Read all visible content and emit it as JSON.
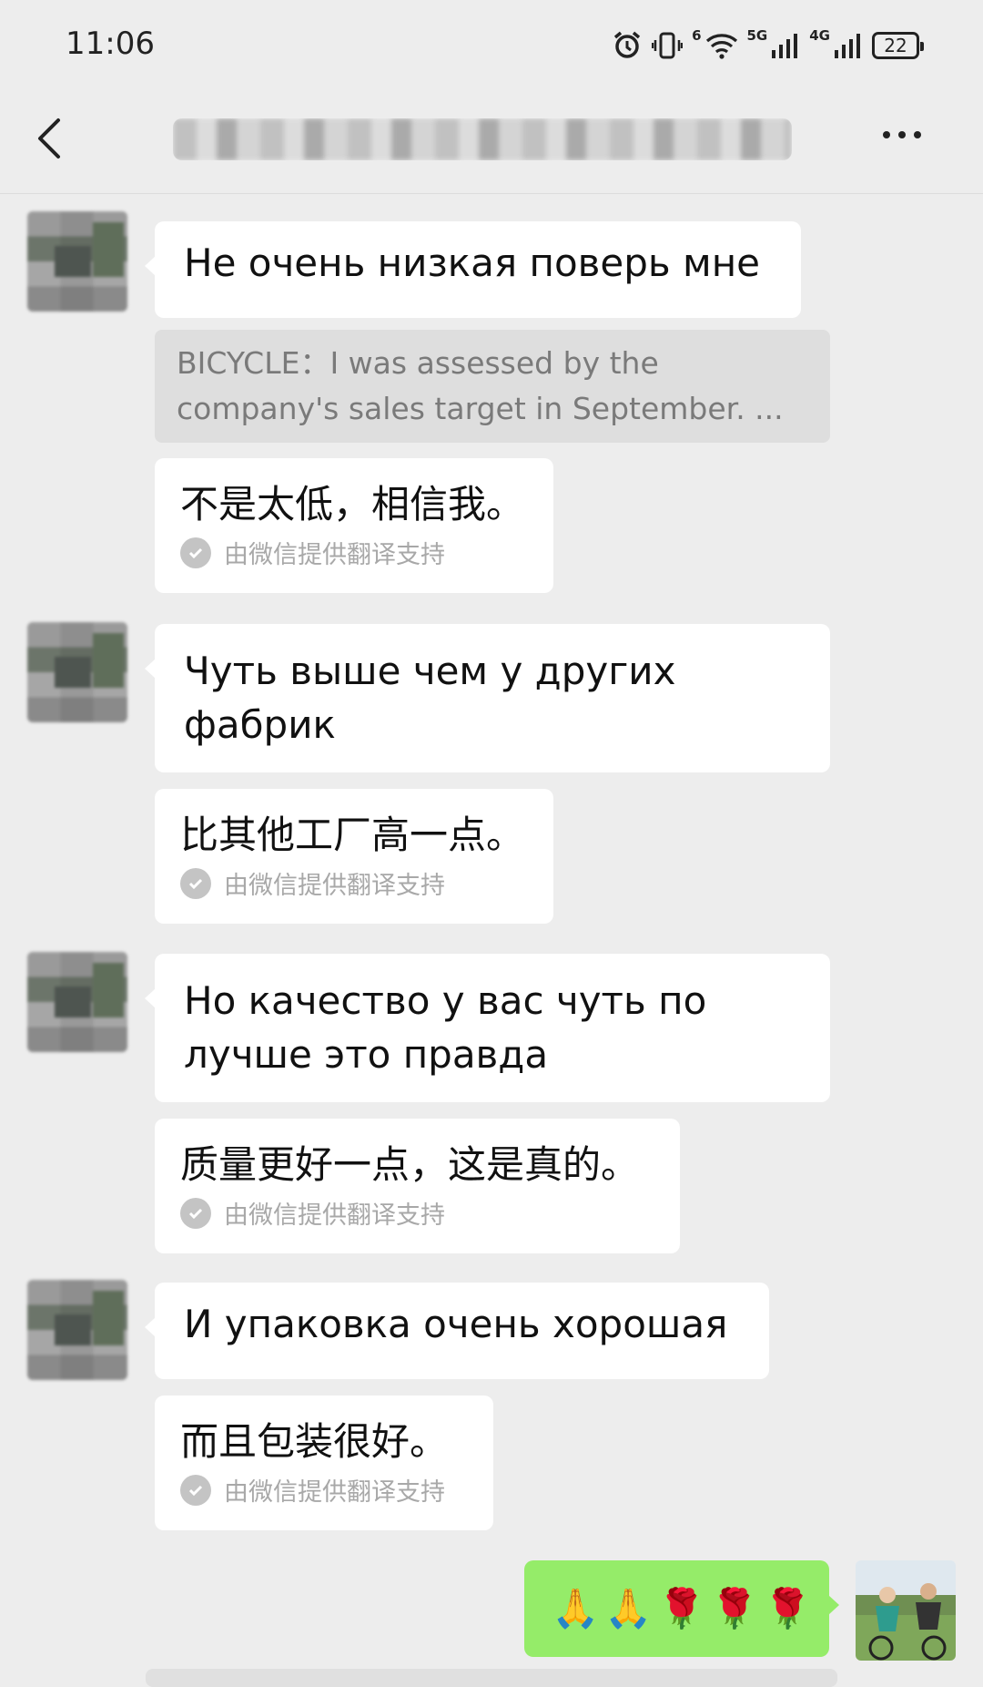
{
  "status_bar": {
    "time": "11:06",
    "network_5g": "5G",
    "network_4g": "4G",
    "wifi_badge": "6",
    "battery": "22"
  },
  "header": {
    "title": "██████████████",
    "back_icon": "chevron-left-icon",
    "more_icon": "ellipsis-icon"
  },
  "messages": [
    {
      "text": "Не очень низкая поверь мне",
      "quote": "BICYCLE：I was assessed by the company's sales target in September. ...",
      "translation": "不是太低，相信我。",
      "translation_note": "由微信提供翻译支持"
    },
    {
      "text": "Чуть выше чем у других фабрик",
      "translation": "比其他工厂高一点。",
      "translation_note": "由微信提供翻译支持"
    },
    {
      "text": "Но качество у вас чуть по лучше это правда",
      "translation": "质量更好一点，这是真的。",
      "translation_note": "由微信提供翻译支持"
    },
    {
      "text": "И упаковка очень хорошая",
      "translation": "而且包装很好。",
      "translation_note": "由微信提供翻译支持"
    }
  ],
  "my_message": {
    "emojis": [
      "🙏",
      "🙏",
      "🌹",
      "🌹",
      "🌹"
    ]
  },
  "colors": {
    "background": "#ededed",
    "bubble": "#ffffff",
    "my_bubble": "#95ec69",
    "quote_bg": "#dedede",
    "note_text": "#a8a8a8"
  }
}
